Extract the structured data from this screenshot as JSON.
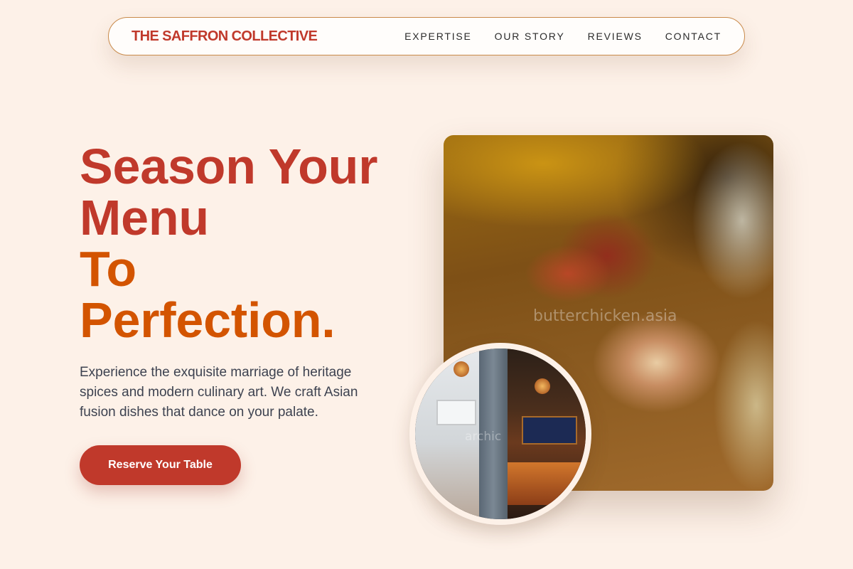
{
  "header": {
    "brand": "THE SAFFRON COLLECTIVE",
    "nav": [
      "EXPERTISE",
      "OUR STORY",
      "REVIEWS",
      "CONTACT"
    ]
  },
  "hero": {
    "title_line1": "Season Your",
    "title_line2": "Menu",
    "title_line3": "To",
    "title_line4": "Perfection.",
    "description": "Experience the exquisite marriage of heritage spices and modern culinary art. We craft Asian fusion dishes that dance on your palate.",
    "cta_label": "Reserve Your Table"
  },
  "images": {
    "main_watermark": "butterchicken.asia",
    "circle_watermark": "archic"
  },
  "colors": {
    "background": "#fdf1e8",
    "brand_red": "#c0392b",
    "accent_orange": "#d35400",
    "nav_border": "#c98a4a",
    "body_text": "#3d4250"
  }
}
